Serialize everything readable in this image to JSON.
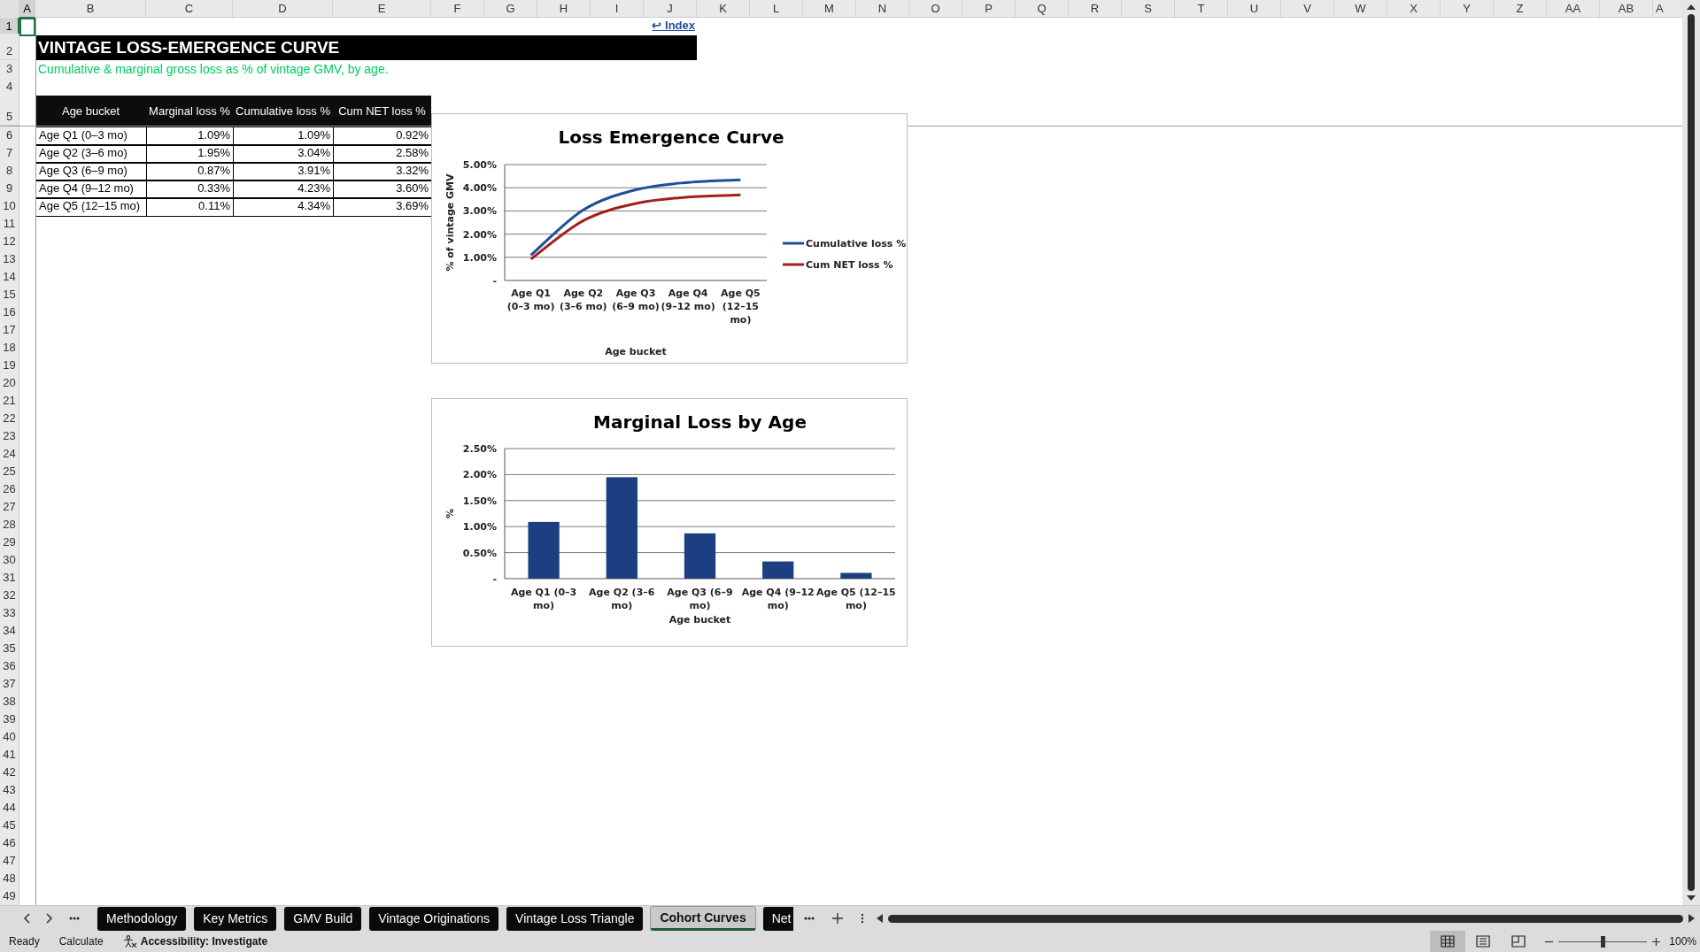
{
  "column_headers": [
    {
      "label": "A",
      "selected": true
    },
    {
      "label": "B",
      "selected": false
    },
    {
      "label": "C",
      "selected": false
    },
    {
      "label": "D",
      "selected": false
    },
    {
      "label": "E",
      "selected": false
    },
    {
      "label": "F",
      "selected": false
    },
    {
      "label": "G",
      "selected": false
    },
    {
      "label": "H",
      "selected": false
    },
    {
      "label": "I",
      "selected": false
    },
    {
      "label": "J",
      "selected": false
    },
    {
      "label": "K",
      "selected": false
    },
    {
      "label": "L",
      "selected": false
    },
    {
      "label": "M",
      "selected": false
    },
    {
      "label": "N",
      "selected": false
    },
    {
      "label": "O",
      "selected": false
    },
    {
      "label": "P",
      "selected": false
    },
    {
      "label": "Q",
      "selected": false
    },
    {
      "label": "R",
      "selected": false
    },
    {
      "label": "S",
      "selected": false
    },
    {
      "label": "T",
      "selected": false
    },
    {
      "label": "U",
      "selected": false
    },
    {
      "label": "V",
      "selected": false
    },
    {
      "label": "W",
      "selected": false
    },
    {
      "label": "X",
      "selected": false
    },
    {
      "label": "Y",
      "selected": false
    },
    {
      "label": "Z",
      "selected": false
    },
    {
      "label": "AA",
      "selected": false
    },
    {
      "label": "AB",
      "selected": false
    },
    {
      "label": "A",
      "selected": false
    }
  ],
  "row_headers": [
    {
      "label": "1",
      "selected": true
    },
    {
      "label": "2",
      "selected": false
    },
    {
      "label": "3",
      "selected": false
    },
    {
      "label": "4",
      "selected": false
    },
    {
      "label": "5",
      "selected": false
    },
    {
      "label": "6",
      "selected": false
    },
    {
      "label": "7",
      "selected": false
    },
    {
      "label": "8",
      "selected": false
    },
    {
      "label": "9",
      "selected": false
    },
    {
      "label": "10",
      "selected": false
    },
    {
      "label": "11",
      "selected": false
    },
    {
      "label": "12",
      "selected": false
    },
    {
      "label": "13",
      "selected": false
    },
    {
      "label": "14",
      "selected": false
    },
    {
      "label": "15",
      "selected": false
    },
    {
      "label": "16",
      "selected": false
    },
    {
      "label": "17",
      "selected": false
    },
    {
      "label": "18",
      "selected": false
    },
    {
      "label": "19",
      "selected": false
    },
    {
      "label": "20",
      "selected": false
    },
    {
      "label": "21",
      "selected": false
    },
    {
      "label": "22",
      "selected": false
    },
    {
      "label": "23",
      "selected": false
    },
    {
      "label": "24",
      "selected": false
    },
    {
      "label": "25",
      "selected": false
    },
    {
      "label": "26",
      "selected": false
    },
    {
      "label": "27",
      "selected": false
    },
    {
      "label": "28",
      "selected": false
    },
    {
      "label": "29",
      "selected": false
    },
    {
      "label": "30",
      "selected": false
    },
    {
      "label": "31",
      "selected": false
    },
    {
      "label": "32",
      "selected": false
    },
    {
      "label": "33",
      "selected": false
    },
    {
      "label": "34",
      "selected": false
    },
    {
      "label": "35",
      "selected": false
    },
    {
      "label": "36",
      "selected": false
    },
    {
      "label": "37",
      "selected": false
    },
    {
      "label": "38",
      "selected": false
    },
    {
      "label": "39",
      "selected": false
    },
    {
      "label": "40",
      "selected": false
    },
    {
      "label": "41",
      "selected": false
    },
    {
      "label": "42",
      "selected": false
    },
    {
      "label": "43",
      "selected": false
    },
    {
      "label": "44",
      "selected": false
    },
    {
      "label": "45",
      "selected": false
    },
    {
      "label": "46",
      "selected": false
    },
    {
      "label": "47",
      "selected": false
    },
    {
      "label": "48",
      "selected": false
    },
    {
      "label": "49",
      "selected": false
    }
  ],
  "index_link": "↩ Index",
  "title": "VINTAGE LOSS-EMERGENCE CURVE",
  "subtitle": "Cumulative & marginal gross loss as % of vintage GMV, by age.",
  "table": {
    "columns": [
      "Age bucket",
      "Marginal loss %",
      "Cumulative loss %",
      "Cum NET loss %"
    ],
    "rows": [
      [
        "Age Q1 (0–3 mo)",
        "1.09%",
        "1.09%",
        "0.92%"
      ],
      [
        "Age Q2 (3–6 mo)",
        "1.95%",
        "3.04%",
        "2.58%"
      ],
      [
        "Age Q3 (6–9 mo)",
        "0.87%",
        "3.91%",
        "3.32%"
      ],
      [
        "Age Q4 (9–12 mo)",
        "0.33%",
        "4.23%",
        "3.60%"
      ],
      [
        "Age Q5 (12–15 mo)",
        "0.11%",
        "4.34%",
        "3.69%"
      ]
    ]
  },
  "charts": [
    {
      "chart_data": {
        "type": "line",
        "title": "Loss Emergence Curve",
        "xlabel": "Age bucket",
        "ylabel": "% of vintage GMV",
        "categories": [
          "Age Q1 (0–3 mo)",
          "Age Q2 (3–6 mo)",
          "Age Q3 (6–9 mo)",
          "Age Q4 (9–12 mo)",
          "Age Q5 (12–15 mo)"
        ],
        "series": [
          {
            "name": "Cumulative loss %",
            "color": "#1f4e9a",
            "values": [
              1.09,
              3.04,
              3.91,
              4.23,
              4.34
            ]
          },
          {
            "name": "Cum NET loss %",
            "color": "#a3201c",
            "values": [
              0.92,
              2.58,
              3.32,
              3.6,
              3.69
            ]
          }
        ],
        "grid": true,
        "legend": true,
        "ylim": [
          0,
          5
        ],
        "yticks": [
          {
            "value": 0,
            "label": "-"
          },
          {
            "value": 1,
            "label": "1.00%"
          },
          {
            "value": 2,
            "label": "2.00%"
          },
          {
            "value": 3,
            "label": "3.00%"
          },
          {
            "value": 4,
            "label": "4.00%"
          },
          {
            "value": 5,
            "label": "5.00%"
          }
        ]
      }
    },
    {
      "chart_data": {
        "type": "bar",
        "title": "Marginal Loss by Age",
        "xlabel": "Age bucket",
        "ylabel": "%",
        "categories": [
          "Age Q1 (0–3 mo)",
          "Age Q2 (3–6 mo)",
          "Age Q3 (6–9 mo)",
          "Age Q4 (9–12 mo)",
          "Age Q5 (12–15 mo)"
        ],
        "values": [
          1.09,
          1.95,
          0.87,
          0.33,
          0.11
        ],
        "grid": true,
        "ylim": [
          0,
          2.5
        ],
        "yticks": [
          {
            "value": 0,
            "label": "-"
          },
          {
            "value": 0.5,
            "label": "0.50%"
          },
          {
            "value": 1,
            "label": "1.00%"
          },
          {
            "value": 1.5,
            "label": "1.50%"
          },
          {
            "value": 2,
            "label": "2.00%"
          },
          {
            "value": 2.5,
            "label": "2.50%"
          }
        ]
      }
    }
  ],
  "sheet_tabs": [
    {
      "label": "Methodology",
      "selected": false
    },
    {
      "label": "Key Metrics",
      "selected": false
    },
    {
      "label": "GMV Build",
      "selected": false
    },
    {
      "label": "Vintage Originations",
      "selected": false
    },
    {
      "label": "Vintage Loss Triangle",
      "selected": false
    },
    {
      "label": "Cohort Curves",
      "selected": true
    },
    {
      "label": "Net",
      "selected": false
    }
  ],
  "status_bar": {
    "status": "Ready",
    "calculate": "Calculate",
    "accessibility": "Accessibility: Investigate",
    "view_buttons": [
      {
        "kind": "normal",
        "selected": true
      },
      {
        "kind": "page_layout",
        "selected": false
      },
      {
        "kind": "page_break",
        "selected": false
      }
    ],
    "zoom": {
      "level": 0.5,
      "reading": "100%"
    }
  }
}
